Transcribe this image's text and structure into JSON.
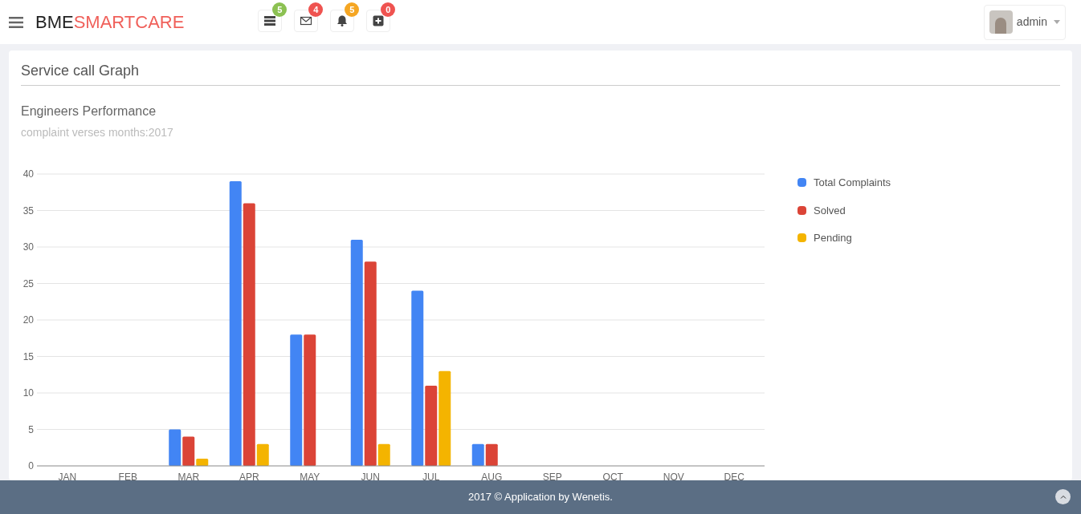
{
  "header": {
    "brand_dark": "BME",
    "brand_accent": "SMARTCARE",
    "notifications": [
      {
        "kind": "list",
        "count": "5",
        "color": "#8cc152"
      },
      {
        "kind": "mail",
        "count": "4",
        "color": "#ef5350"
      },
      {
        "kind": "bell",
        "count": "5",
        "color": "#f5a623"
      },
      {
        "kind": "plus",
        "count": "0",
        "color": "#ef5350"
      }
    ],
    "user": {
      "name": "admin"
    }
  },
  "panel": {
    "title": "Service call Graph",
    "subtitle": "Engineers Performance",
    "caption": "complaint verses months:2017",
    "chart_data": {
      "type": "bar",
      "grid": true,
      "categories": [
        "JAN",
        "FEB",
        "MAR",
        "APR",
        "MAY",
        "JUN",
        "JUL",
        "AUG",
        "SEP",
        "OCT",
        "NOV",
        "DEC"
      ],
      "ylim": [
        0,
        40
      ],
      "yticks": [
        0,
        5,
        10,
        15,
        20,
        25,
        30,
        35,
        40
      ],
      "series": [
        {
          "name": "Total Complaints",
          "color": "#4285f4",
          "values": [
            0,
            0,
            5,
            39,
            18,
            31,
            24,
            3,
            0,
            0,
            0,
            0
          ]
        },
        {
          "name": "Solved",
          "color": "#db4437",
          "values": [
            0,
            0,
            4,
            36,
            18,
            28,
            11,
            3,
            0,
            0,
            0,
            0
          ]
        },
        {
          "name": "Pending",
          "color": "#f4b400",
          "values": [
            0,
            0,
            1,
            3,
            0,
            3,
            13,
            0,
            0,
            0,
            0,
            0
          ]
        }
      ]
    }
  },
  "footer": {
    "text": "2017 © Application by Wenetis."
  }
}
